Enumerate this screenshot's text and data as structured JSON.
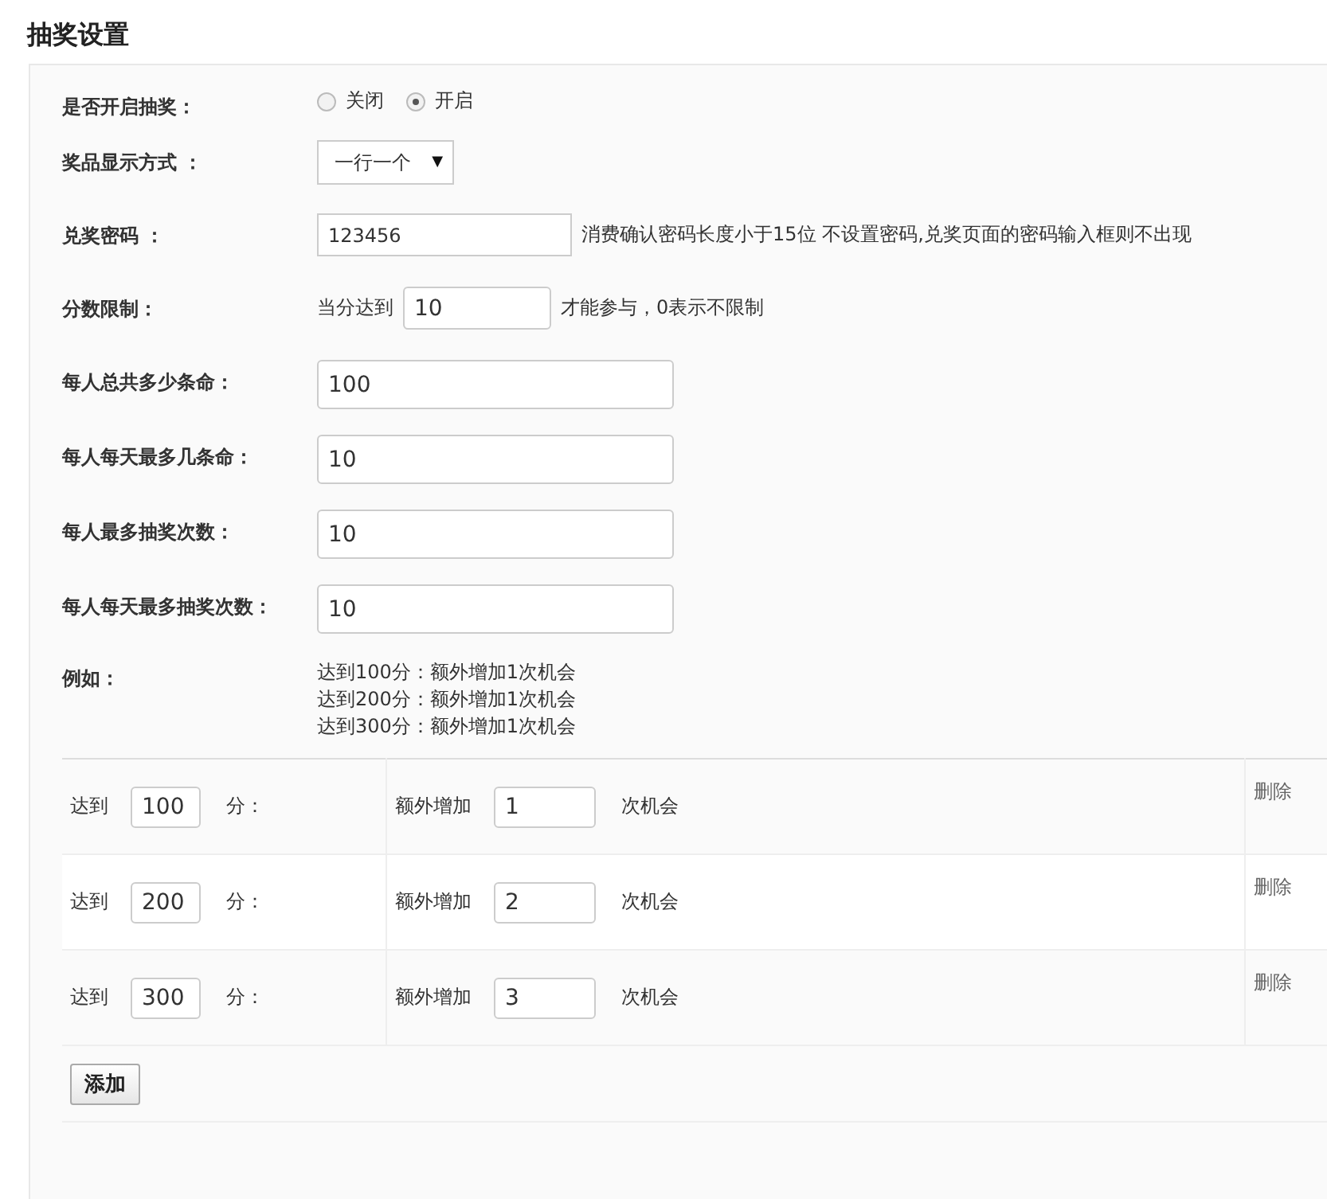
{
  "title": "抽奖设置",
  "fields": [
    {
      "kind": "radio",
      "label": "是否开启抽奖：",
      "options": [
        {
          "label": "关闭",
          "selected": false
        },
        {
          "label": "开启",
          "selected": true
        }
      ]
    },
    {
      "kind": "select",
      "label": "奖品显示方式 ：",
      "value": "一行一个",
      "caret": "▼"
    },
    {
      "kind": "password",
      "label": "兑奖密码 ：",
      "value": "123456",
      "hint": "消费确认密码长度小于15位 不设置密码,兑奖页面的密码输入框则不出现"
    },
    {
      "kind": "limit",
      "label": "分数限制：",
      "prefix": "当分达到",
      "value": "10",
      "suffix": "才能参与，0表示不限制"
    },
    {
      "kind": "input",
      "label": "每人总共多少条命：",
      "value": "100"
    },
    {
      "kind": "input",
      "label": "每人每天最多几条命：",
      "value": "10"
    },
    {
      "kind": "input",
      "label": "每人最多抽奖次数：",
      "value": "10"
    },
    {
      "kind": "input",
      "label": "每人每天最多抽奖次数：",
      "value": "10"
    },
    {
      "kind": "example",
      "label": "例如：",
      "lines": [
        "达到100分：额外增加1次机会",
        "达到200分：额外增加1次机会",
        "达到300分：额外增加1次机会"
      ]
    }
  ],
  "rules": [
    {
      "reach": "达到",
      "score": "100",
      "unit": "分：",
      "extra": "额外增加",
      "times": "1",
      "times_unit": "次机会",
      "delete": "删除"
    },
    {
      "reach": "达到",
      "score": "200",
      "unit": "分：",
      "extra": "额外增加",
      "times": "2",
      "times_unit": "次机会",
      "delete": "删除"
    },
    {
      "reach": "达到",
      "score": "300",
      "unit": "分：",
      "extra": "额外增加",
      "times": "3",
      "times_unit": "次机会",
      "delete": "删除"
    }
  ],
  "add_button": "添加"
}
